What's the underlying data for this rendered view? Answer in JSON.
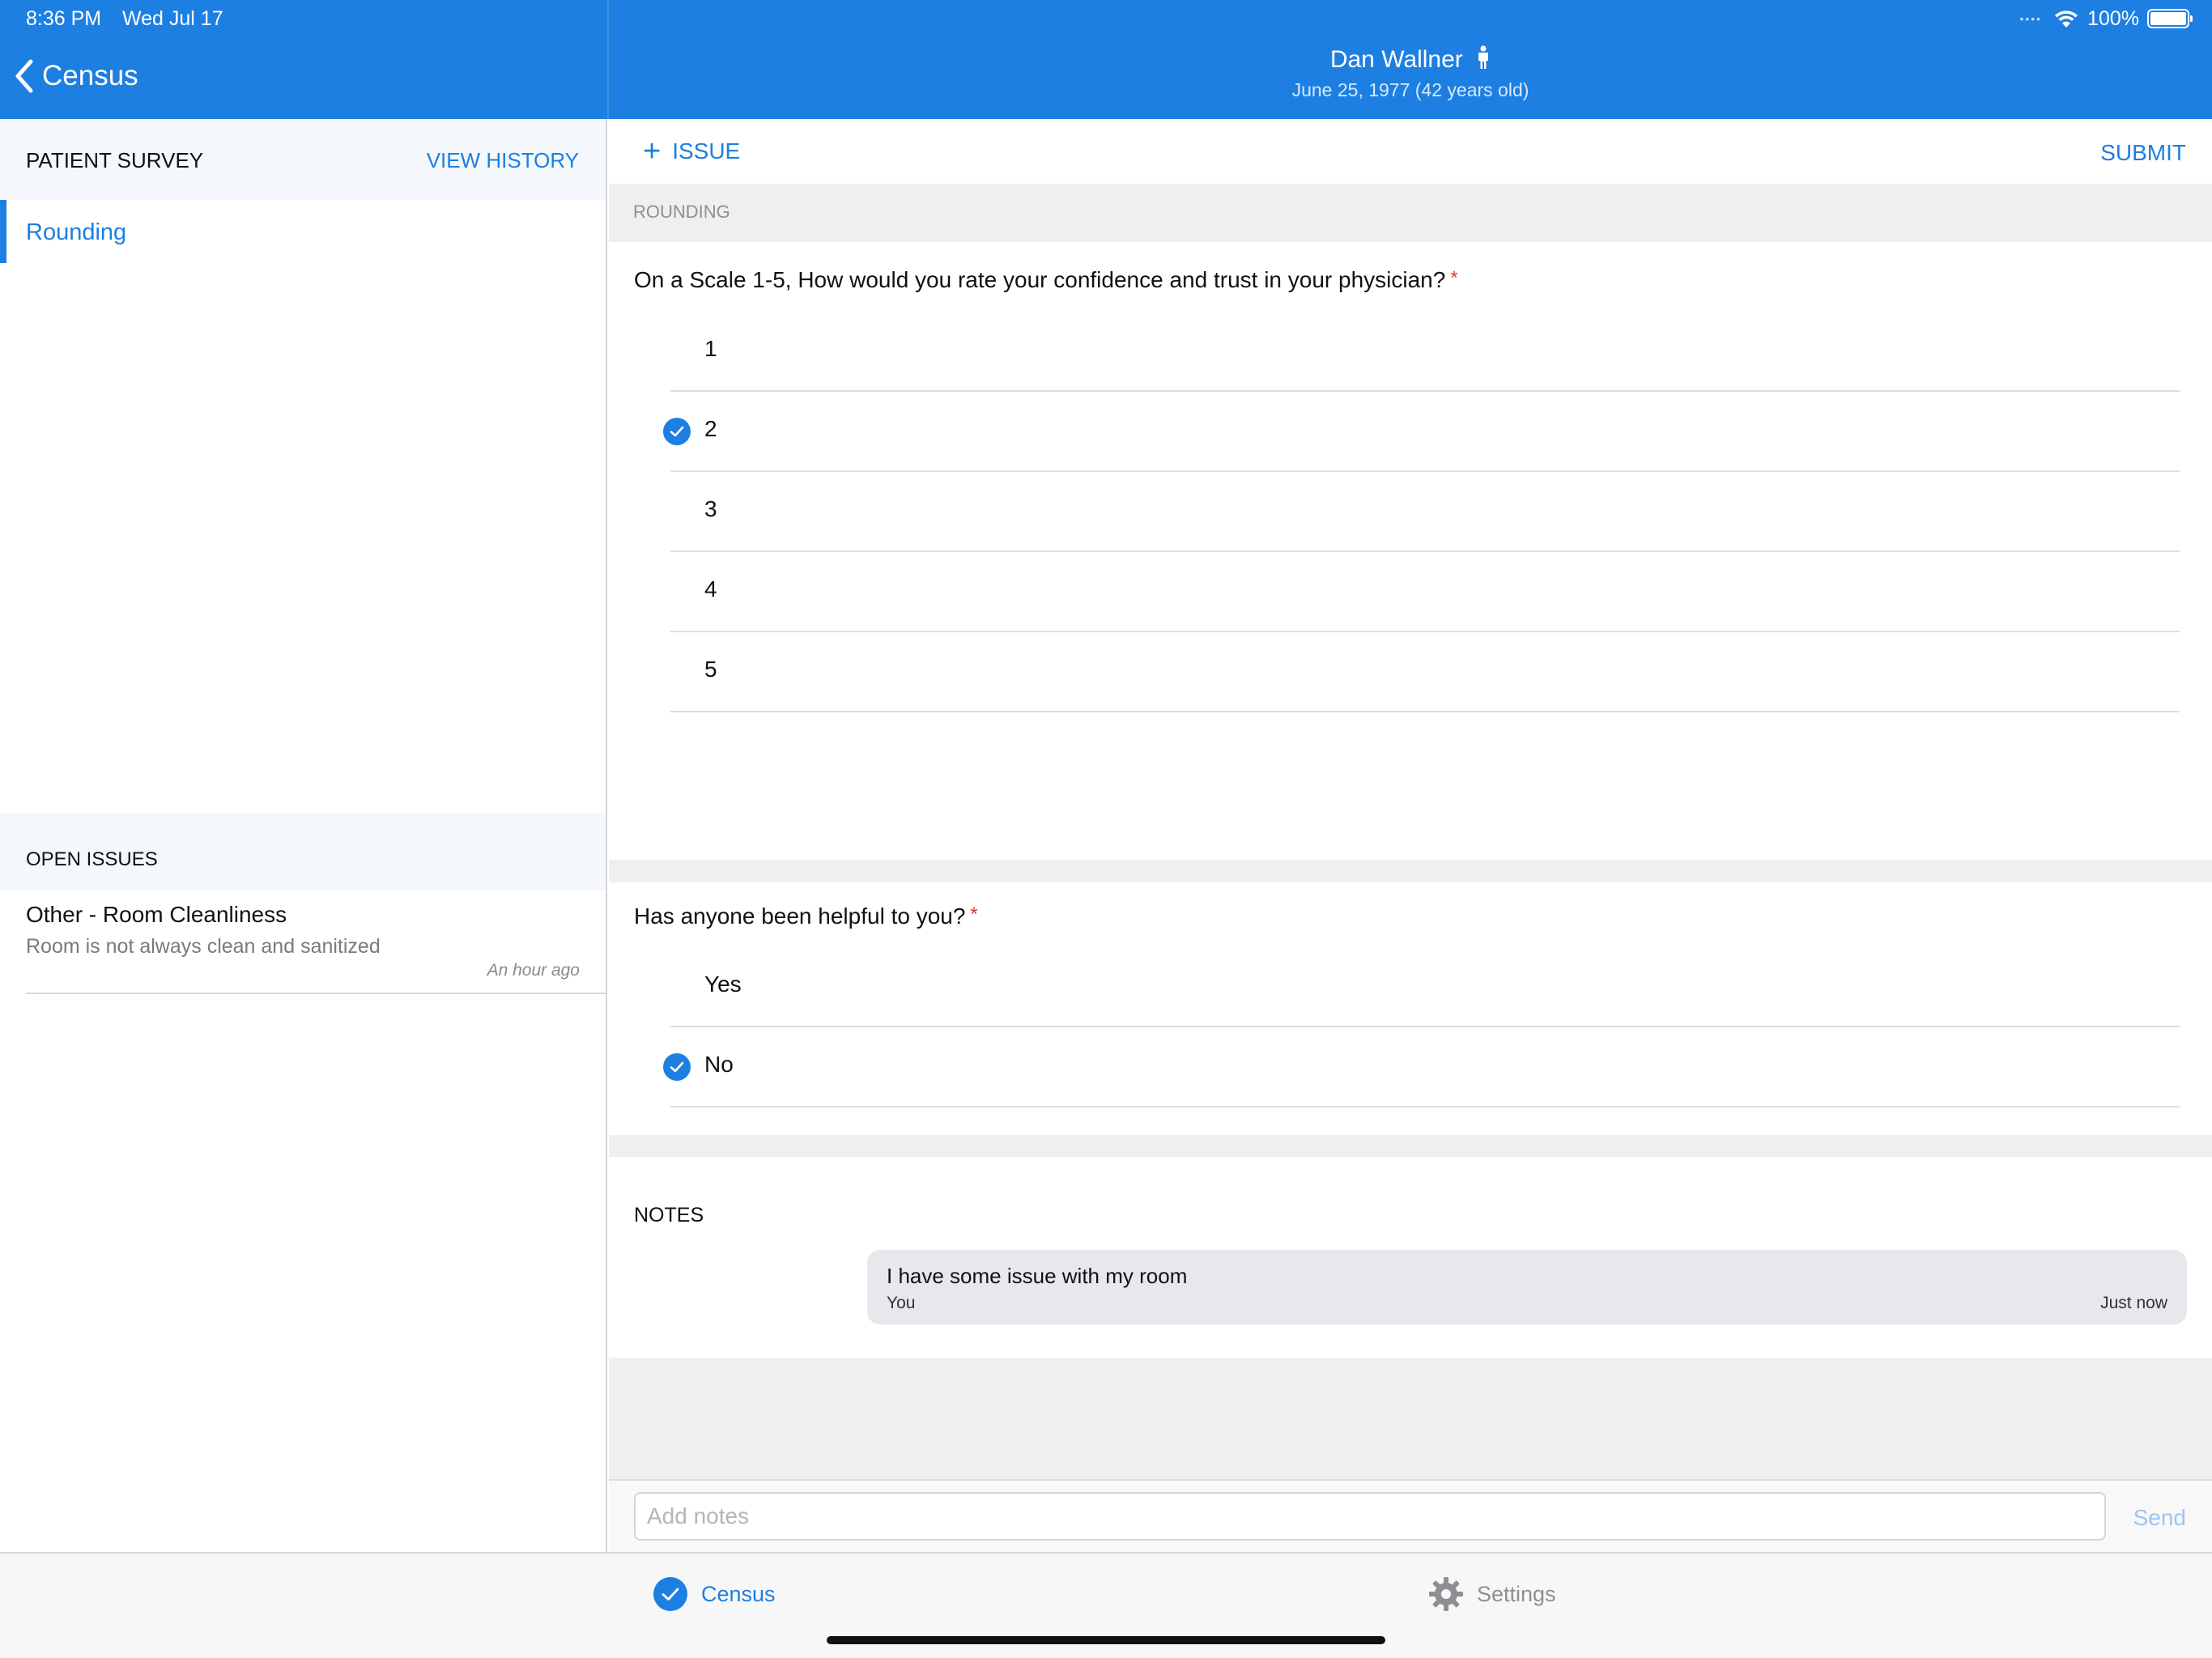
{
  "status_bar": {
    "time": "8:36 PM",
    "date": "Wed Jul 17",
    "battery": "100%"
  },
  "nav": {
    "back_label": "Census",
    "patient_name": "Dan Wallner",
    "patient_dob": "June 25, 1977 (42 years old)"
  },
  "sidebar": {
    "survey_title": "PATIENT SURVEY",
    "view_history": "VIEW HISTORY",
    "items": [
      {
        "label": "Rounding",
        "selected": true
      }
    ],
    "issues_title": "OPEN ISSUES",
    "issues": [
      {
        "title": "Other - Room Cleanliness",
        "description": "Room is not always clean and sanitized",
        "time": "An hour ago"
      }
    ]
  },
  "toolbar": {
    "add_issue": "ISSUE",
    "submit": "SUBMIT"
  },
  "survey": {
    "section": "ROUNDING",
    "questions": [
      {
        "text": "On a Scale 1-5, How would you rate your confidence and trust in your physician?",
        "required_mark": "*",
        "options": [
          "1",
          "2",
          "3",
          "4",
          "5"
        ],
        "selected": "2"
      },
      {
        "text": "Has anyone been helpful to you?",
        "required_mark": "*",
        "options": [
          "Yes",
          "No"
        ],
        "selected": "No"
      }
    ]
  },
  "notes": {
    "title": "NOTES",
    "entries": [
      {
        "text": "I have some issue with my room",
        "author": "You",
        "time": "Just now"
      }
    ],
    "input_placeholder": "Add notes",
    "send_label": "Send"
  },
  "tabbar": {
    "tabs": [
      {
        "label": "Census",
        "icon": "checkmark-circle-icon",
        "active": true
      },
      {
        "label": "Settings",
        "icon": "gear-icon",
        "active": false
      }
    ]
  },
  "colors": {
    "accent": "#1d7fe1",
    "required": "#e53935",
    "background": "#efefef"
  }
}
